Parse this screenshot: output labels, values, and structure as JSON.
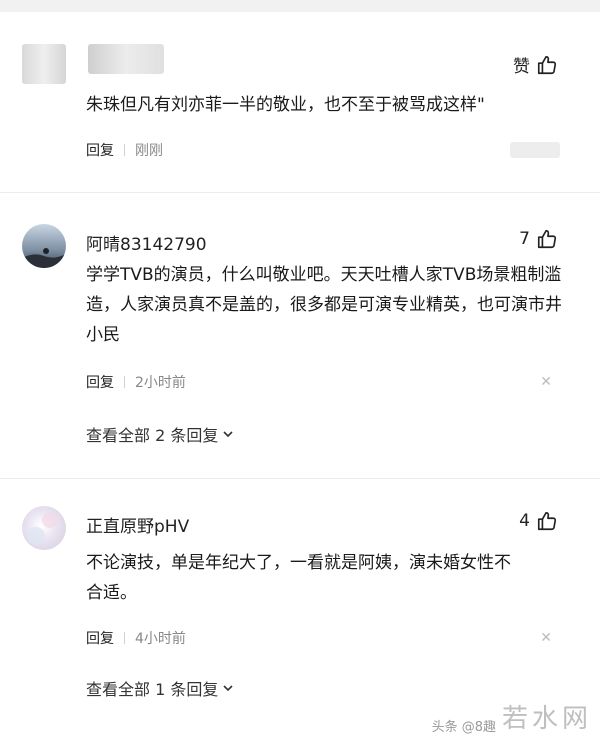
{
  "comments": [
    {
      "username": "",
      "like_label": "赞",
      "content": "朱珠但凡有刘亦菲一半的敬业，也不至于被骂成这样\"",
      "reply_label": "回复",
      "time": "刚刚"
    },
    {
      "username": "阿晴83142790",
      "like_count": "7",
      "content": "学学TVB的演员，什么叫敬业吧。天天吐槽人家TVB场景粗制滥造，人家演员真不是盖的，很多都是可演专业精英，也可演市井小民",
      "reply_label": "回复",
      "time": "2小时前",
      "view_all": "查看全部 2 条回复"
    },
    {
      "username": "正直原野pHV",
      "like_count": "4",
      "content": "不论演技，单是年纪大了，一看就是阿姨，演未婚女性不合适。",
      "reply_label": "回复",
      "time": "4小时前",
      "view_all": "查看全部 1 条回复"
    }
  ],
  "watermark": {
    "logo": "若水网",
    "source": "头条 @8趣"
  }
}
